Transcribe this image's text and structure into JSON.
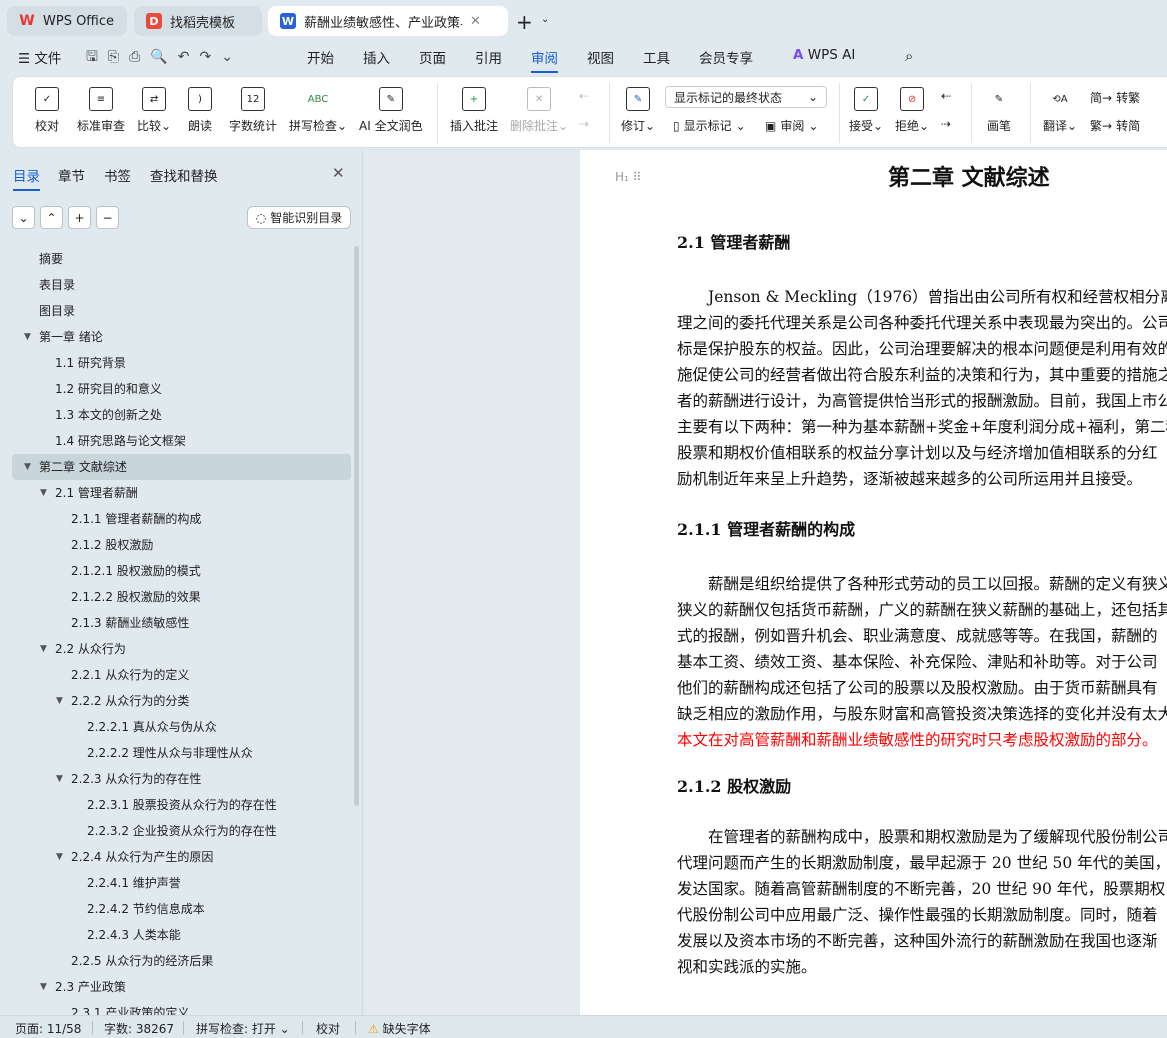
{
  "tabs": [
    {
      "label": "WPS Office",
      "icon": "wps-logo"
    },
    {
      "label": "找稻壳模板",
      "icon": "docer-logo"
    },
    {
      "label": "薪酬业绩敏感性、产业政策与管",
      "icon": "word-doc-icon",
      "active": true
    }
  ],
  "menu": {
    "file": "文件",
    "items": [
      "开始",
      "插入",
      "页面",
      "引用",
      "审阅",
      "视图",
      "工具",
      "会员专享"
    ],
    "active": "审阅",
    "ai": "WPS AI"
  },
  "ribbon": {
    "buttons": [
      "校对",
      "标准审查",
      "比较",
      "朗读",
      "字数统计",
      "拼写检查",
      "AI 全文润色",
      "插入批注",
      "删除批注"
    ],
    "markup_select": "显示标记的最终状态",
    "revise": "修订",
    "show_markup": "显示标记",
    "review": "审阅",
    "accept": "接受",
    "reject": "拒绝",
    "pen": "画笔",
    "translate": "翻译",
    "to_trad": "转繁",
    "to_simp": "转简"
  },
  "sidebar": {
    "tabs": [
      "目录",
      "章节",
      "书签",
      "查找和替换"
    ],
    "smart": "智能识别目录",
    "toc": [
      {
        "t": "摘要",
        "l": 0
      },
      {
        "t": "表目录",
        "l": 0
      },
      {
        "t": "图目录",
        "l": 0
      },
      {
        "t": "第一章  绪论",
        "l": 0,
        "exp": true
      },
      {
        "t": "1.1  研究背景",
        "l": 1
      },
      {
        "t": "1.2  研究目的和意义",
        "l": 1
      },
      {
        "t": "1.3  本文的创新之处",
        "l": 1
      },
      {
        "t": "1.4  研究思路与论文框架",
        "l": 1
      },
      {
        "t": "第二章  文献综述",
        "l": 0,
        "exp": true,
        "sel": true
      },
      {
        "t": "2.1  管理者薪酬",
        "l": 1,
        "exp": true
      },
      {
        "t": "2.1.1  管理者薪酬的构成",
        "l": 2
      },
      {
        "t": "2.1.2  股权激励",
        "l": 2
      },
      {
        "t": "2.1.2.1  股权激励的模式",
        "l": 2
      },
      {
        "t": "2.1.2.2  股权激励的效果",
        "l": 2
      },
      {
        "t": "2.1.3  薪酬业绩敏感性",
        "l": 2
      },
      {
        "t": "2.2  从众行为",
        "l": 1,
        "exp": true
      },
      {
        "t": "2.2.1  从众行为的定义",
        "l": 2
      },
      {
        "t": "2.2.2  从众行为的分类",
        "l": 2,
        "exp": true
      },
      {
        "t": "2.2.2.1  真从众与伪从众",
        "l": 3
      },
      {
        "t": "2.2.2.2  理性从众与非理性从众",
        "l": 3
      },
      {
        "t": "2.2.3  从众行为的存在性",
        "l": 2,
        "exp": true
      },
      {
        "t": "2.2.3.1  股票投资从众行为的存在性",
        "l": 3
      },
      {
        "t": "2.2.3.2  企业投资从众行为的存在性",
        "l": 3
      },
      {
        "t": "2.2.4 从众行为产生的原因",
        "l": 2,
        "exp": true
      },
      {
        "t": "2.2.4.1  维护声誉",
        "l": 3
      },
      {
        "t": "2.2.4.2  节约信息成本",
        "l": 3
      },
      {
        "t": "2.2.4.3  人类本能",
        "l": 3
      },
      {
        "t": "2.2.5  从众行为的经济后果",
        "l": 2
      },
      {
        "t": "2.3  产业政策",
        "l": 1,
        "exp": true
      },
      {
        "t": "2.3.1  产业政策的定义",
        "l": 2
      }
    ]
  },
  "doc": {
    "chapter": "第二章  文献综述",
    "h1": "2.1  管理者薪酬",
    "p1": [
      "　　Jenson & Meckling（1976）曾指出由公司所有权和经营权相分离而产",
      "理之间的委托代理关系是公司各种委托代理关系中表现最为突出的。公司",
      "标是保护股东的权益。因此，公司治理要解决的根本问题便是利用有效的",
      "施促使公司的经营者做出符合股东利益的决策和行为，其中重要的措施之",
      "者的薪酬进行设计，为高管提供恰当形式的报酬激励。目前，我国上市公",
      "主要有以下两种：第一种为基本薪酬+奖金+年度利润分成+福利，第二种",
      "股票和期权价值相联系的权益分享计划以及与经济增加值相联系的分红",
      "励机制近年来呈上升趋势，逐渐被越来越多的公司所运用并且接受。"
    ],
    "h2": "2.1.1  管理者薪酬的构成",
    "p2": [
      "　　薪酬是组织给提供了各种形式劳动的员工以回报。薪酬的定义有狭义",
      "狭义的薪酬仅包括货币薪酬，广义的薪酬在狭义薪酬的基础上，还包括其",
      "式的报酬，例如晋升机会、职业满意度、成就感等等。在我国，薪酬的",
      "基本工资、绩效工资、基本保险、补充保险、津贴和补助等。对于公司",
      "他们的薪酬构成还包括了公司的股票以及股权激励。由于货币薪酬具有",
      "缺乏相应的激励作用，与股东财富和高管投资决策选择的变化并没有太大"
    ],
    "p2_red": "本文在对高管薪酬和薪酬业绩敏感性的研究时只考虑股权激励的部分。",
    "h3": "2.1.2  股权激励",
    "p3": [
      "　　在管理者的薪酬构成中，股票和期权激励是为了缓解现代股份制公司",
      "代理问题而产生的长期激励制度，最早起源于 20 世纪 50 年代的美国，",
      "发达国家。随着高管薪酬制度的不断完善，20 世纪 90 年代，股票期权",
      "代股份制公司中应用最广泛、操作性最强的长期激励制度。同时，随着",
      "发展以及资本市场的不断完善，这种国外流行的薪酬激励在我国也逐渐",
      "视和实践派的实施。"
    ]
  },
  "status": {
    "page": "页面: 11/58",
    "words": "字数: 38267",
    "spell": "拼写检查: 打开",
    "proof": "校对",
    "font": "缺失字体"
  },
  "colors": {
    "accent": "#1a5fd0",
    "red_text": "#ff0000"
  }
}
